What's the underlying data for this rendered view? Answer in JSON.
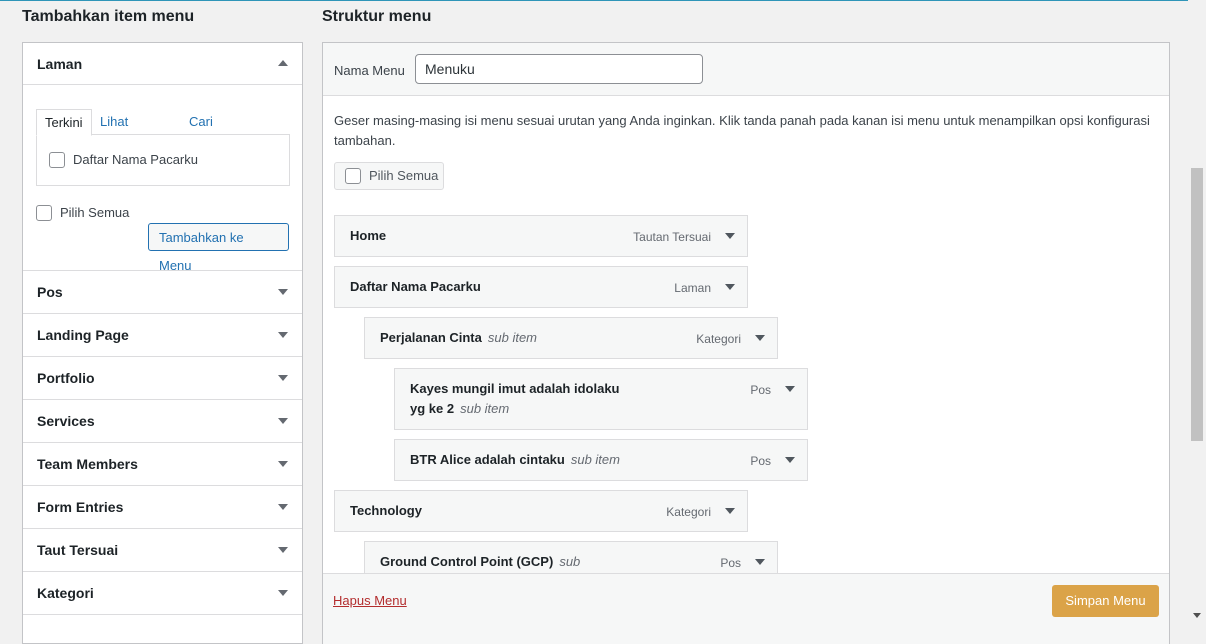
{
  "left": {
    "title": "Tambahkan item menu",
    "open_section": {
      "label": "Laman",
      "tabs": [
        {
          "label": "Terkini",
          "active": true
        },
        {
          "label": "Lihat Semua",
          "active": false
        },
        {
          "label": "Cari",
          "active": false
        }
      ],
      "items": [
        {
          "label": "Daftar Nama Pacarku",
          "checked": false
        }
      ],
      "select_all": "Pilih Semua",
      "add_button": "Tambahkan ke Menu"
    },
    "sections": [
      "Pos",
      "Landing Page",
      "Portfolio",
      "Services",
      "Team Members",
      "Form Entries",
      "Taut Tersuai",
      "Kategori"
    ]
  },
  "right": {
    "title": "Struktur menu",
    "name_label": "Nama Menu",
    "name_value": "Menuku",
    "description": "Geser masing-masing isi menu sesuai urutan yang Anda inginkan. Klik tanda panah pada kanan isi menu untuk menampilkan opsi konfigurasi tambahan.",
    "select_all": "Pilih Semua",
    "menu_items": [
      {
        "title": "Home",
        "sub": "",
        "type": "Tautan Tersuai",
        "depth": 0
      },
      {
        "title": "Daftar Nama Pacarku",
        "sub": "",
        "type": "Laman",
        "depth": 0
      },
      {
        "title": "Perjalanan Cinta",
        "sub": "sub item",
        "type": "Kategori",
        "depth": 1
      },
      {
        "title": "Kayes mungil imut adalah idolaku",
        "title2": "yg ke 2",
        "sub": "sub item",
        "type": "Pos",
        "depth": 2
      },
      {
        "title": "BTR Alice adalah cintaku",
        "sub": "sub item",
        "type": "Pos",
        "depth": 2
      },
      {
        "title": "Technology",
        "sub": "",
        "type": "Kategori",
        "depth": 0
      },
      {
        "title": "Ground Control Point (GCP)",
        "sub": "sub",
        "type": "Pos",
        "depth": 1
      }
    ],
    "delete_link": "Hapus Menu",
    "save_button": "Simpan Menu"
  },
  "colors": {
    "accent": "#2271b1",
    "save": "#dba348",
    "danger": "#b32d2e"
  }
}
